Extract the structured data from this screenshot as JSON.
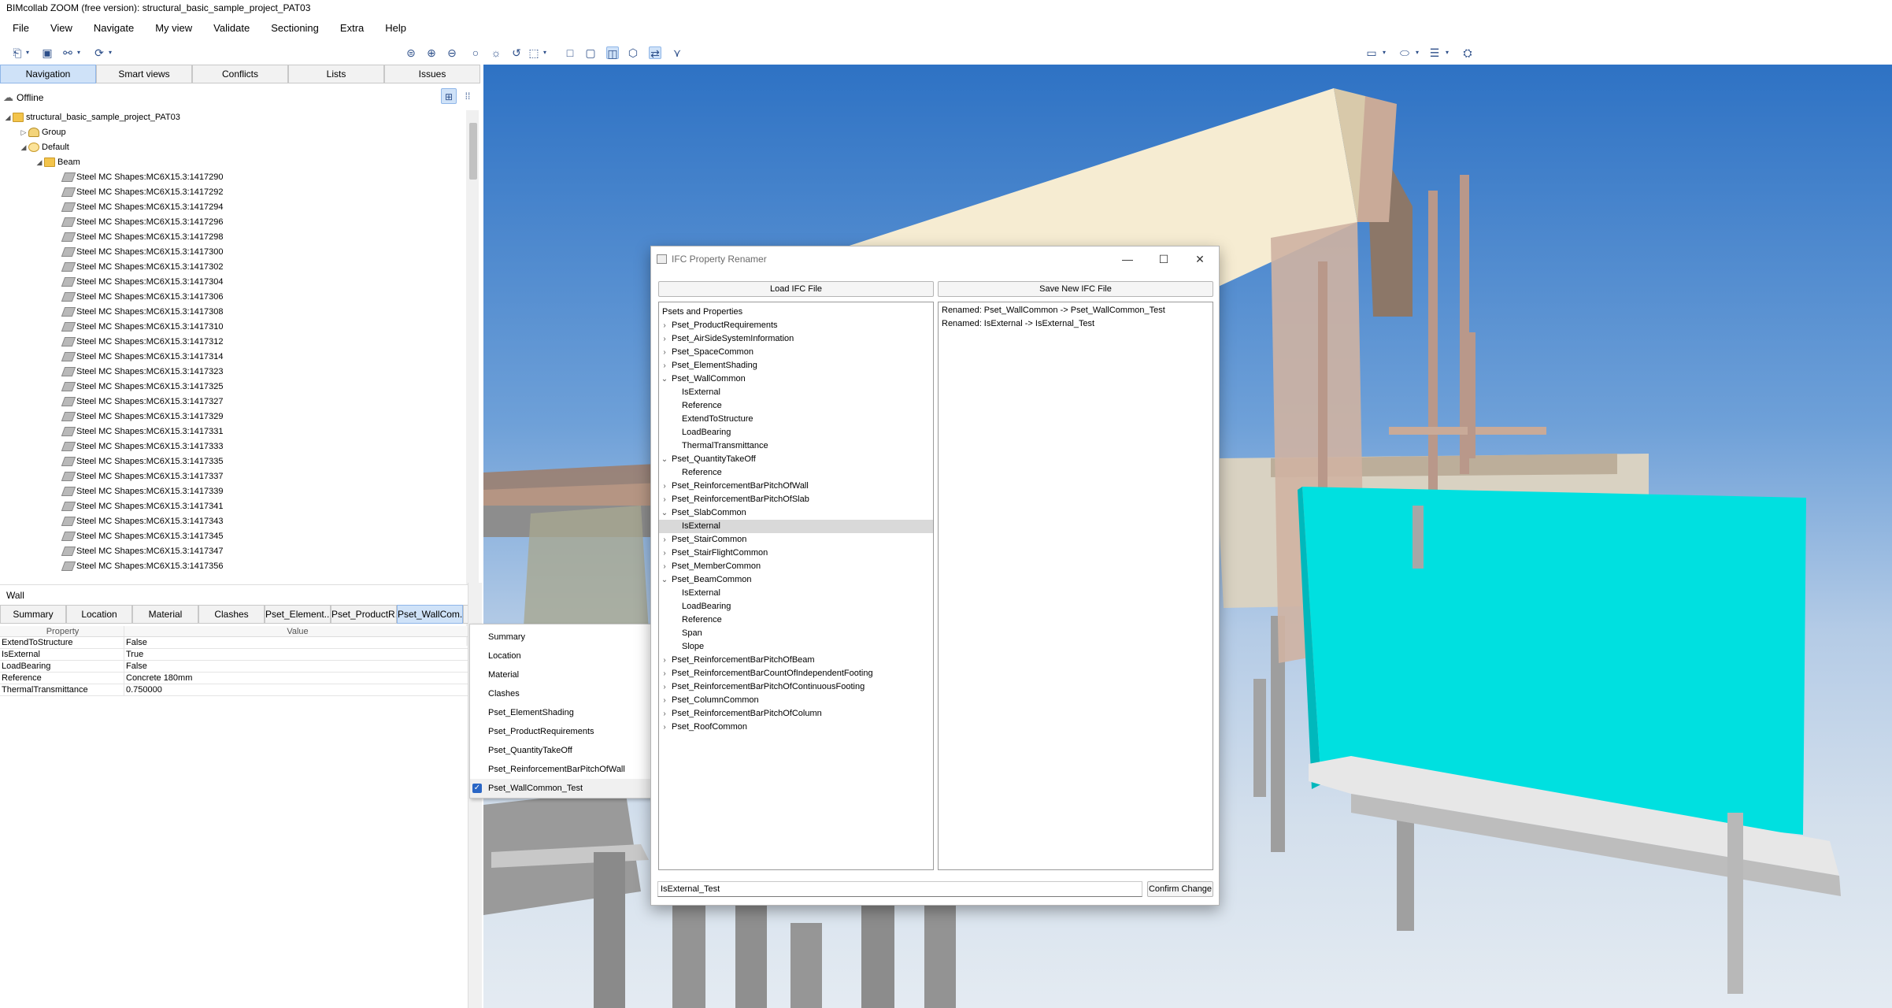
{
  "app": {
    "title": "BIMcollab ZOOM (free version): structural_basic_sample_project_PAT03"
  },
  "menu": [
    "File",
    "View",
    "Navigate",
    "My view",
    "Validate",
    "Sectioning",
    "Extra",
    "Help"
  ],
  "toolbar_icons": {
    "left": [
      "open-icon",
      "save-icon",
      "link-icon",
      "refresh-icon"
    ],
    "center": [
      "zoom-fit-icon",
      "zoom-in-icon",
      "zoom-out-icon",
      "target-icon",
      "sun-icon",
      "rotate-icon",
      "select-icon",
      "box-icon",
      "box-filled-icon",
      "section-box-icon",
      "cube-icon",
      "walk-icon",
      "measure-icon"
    ],
    "right": [
      "line-style-icon",
      "ellipse-icon",
      "menu-lines-icon",
      "settings-icon"
    ]
  },
  "nav_tabs": [
    "Navigation",
    "Smart views",
    "Conflicts",
    "Lists",
    "Issues"
  ],
  "status": {
    "offline": "Offline"
  },
  "tree": {
    "project": "structural_basic_sample_project_PAT03",
    "group": "Group",
    "default": "Default",
    "beam": "Beam",
    "items": [
      "Steel MC Shapes:MC6X15.3:1417290",
      "Steel MC Shapes:MC6X15.3:1417292",
      "Steel MC Shapes:MC6X15.3:1417294",
      "Steel MC Shapes:MC6X15.3:1417296",
      "Steel MC Shapes:MC6X15.3:1417298",
      "Steel MC Shapes:MC6X15.3:1417300",
      "Steel MC Shapes:MC6X15.3:1417302",
      "Steel MC Shapes:MC6X15.3:1417304",
      "Steel MC Shapes:MC6X15.3:1417306",
      "Steel MC Shapes:MC6X15.3:1417308",
      "Steel MC Shapes:MC6X15.3:1417310",
      "Steel MC Shapes:MC6X15.3:1417312",
      "Steel MC Shapes:MC6X15.3:1417314",
      "Steel MC Shapes:MC6X15.3:1417323",
      "Steel MC Shapes:MC6X15.3:1417325",
      "Steel MC Shapes:MC6X15.3:1417327",
      "Steel MC Shapes:MC6X15.3:1417329",
      "Steel MC Shapes:MC6X15.3:1417331",
      "Steel MC Shapes:MC6X15.3:1417333",
      "Steel MC Shapes:MC6X15.3:1417335",
      "Steel MC Shapes:MC6X15.3:1417337",
      "Steel MC Shapes:MC6X15.3:1417339",
      "Steel MC Shapes:MC6X15.3:1417341",
      "Steel MC Shapes:MC6X15.3:1417343",
      "Steel MC Shapes:MC6X15.3:1417345",
      "Steel MC Shapes:MC6X15.3:1417347",
      "Steel MC Shapes:MC6X15.3:1417356"
    ]
  },
  "properties": {
    "title": "Wall",
    "tabs": [
      "Summary",
      "Location",
      "Material",
      "Clashes",
      "Pset_Element...",
      "Pset_ProductR...",
      "Pset_WallCom..."
    ],
    "columns": [
      "Property",
      "Value"
    ],
    "rows": [
      [
        "ExtendToStructure",
        "False"
      ],
      [
        "IsExternal",
        "True"
      ],
      [
        "LoadBearing",
        "False"
      ],
      [
        "Reference",
        "Concrete 180mm"
      ],
      [
        "ThermalTransmittance",
        "0.750000"
      ]
    ]
  },
  "dropdown": {
    "items": [
      "Summary",
      "Location",
      "Material",
      "Clashes",
      "Pset_ElementShading",
      "Pset_ProductRequirements",
      "Pset_QuantityTakeOff",
      "Pset_ReinforcementBarPitchOfWall",
      "Pset_WallCommon_Test"
    ],
    "checked": "Pset_WallCommon_Test"
  },
  "dialog": {
    "title": "IFC Property Renamer",
    "load_button": "Load IFC File",
    "save_button": "Save New IFC File",
    "tree_header": "Psets and Properties",
    "tree": [
      {
        "label": "Pset_ProductRequirements",
        "level": 0,
        "state": "collapsed"
      },
      {
        "label": "Pset_AirSideSystemInformation",
        "level": 0,
        "state": "collapsed"
      },
      {
        "label": "Pset_SpaceCommon",
        "level": 0,
        "state": "collapsed"
      },
      {
        "label": "Pset_ElementShading",
        "level": 0,
        "state": "collapsed"
      },
      {
        "label": "Pset_WallCommon",
        "level": 0,
        "state": "expanded"
      },
      {
        "label": "IsExternal",
        "level": 1
      },
      {
        "label": "Reference",
        "level": 1
      },
      {
        "label": "ExtendToStructure",
        "level": 1
      },
      {
        "label": "LoadBearing",
        "level": 1
      },
      {
        "label": "ThermalTransmittance",
        "level": 1
      },
      {
        "label": "Pset_QuantityTakeOff",
        "level": 0,
        "state": "expanded"
      },
      {
        "label": "Reference",
        "level": 1
      },
      {
        "label": "Pset_ReinforcementBarPitchOfWall",
        "level": 0,
        "state": "collapsed"
      },
      {
        "label": "Pset_ReinforcementBarPitchOfSlab",
        "level": 0,
        "state": "collapsed"
      },
      {
        "label": "Pset_SlabCommon",
        "level": 0,
        "state": "expanded"
      },
      {
        "label": "IsExternal",
        "level": 1,
        "selected": true
      },
      {
        "label": "Pset_StairCommon",
        "level": 0,
        "state": "collapsed"
      },
      {
        "label": "Pset_StairFlightCommon",
        "level": 0,
        "state": "collapsed"
      },
      {
        "label": "Pset_MemberCommon",
        "level": 0,
        "state": "collapsed"
      },
      {
        "label": "Pset_BeamCommon",
        "level": 0,
        "state": "expanded"
      },
      {
        "label": "IsExternal",
        "level": 1
      },
      {
        "label": "LoadBearing",
        "level": 1
      },
      {
        "label": "Reference",
        "level": 1
      },
      {
        "label": "Span",
        "level": 1
      },
      {
        "label": "Slope",
        "level": 1
      },
      {
        "label": "Pset_ReinforcementBarPitchOfBeam",
        "level": 0,
        "state": "collapsed"
      },
      {
        "label": "Pset_ReinforcementBarCountOfIndependentFooting",
        "level": 0,
        "state": "collapsed"
      },
      {
        "label": "Pset_ReinforcementBarPitchOfContinuousFooting",
        "level": 0,
        "state": "collapsed"
      },
      {
        "label": "Pset_ColumnCommon",
        "level": 0,
        "state": "collapsed"
      },
      {
        "label": "Pset_ReinforcementBarPitchOfColumn",
        "level": 0,
        "state": "collapsed"
      },
      {
        "label": "Pset_RoofCommon",
        "level": 0,
        "state": "collapsed"
      }
    ],
    "log": [
      "Renamed: Pset_WallCommon -> Pset_WallCommon_Test",
      "Renamed: IsExternal -> IsExternal_Test"
    ],
    "input_value": "IsExternal_Test",
    "confirm_button": "Confirm Change"
  },
  "colors": {
    "tab_active_bg": "#cfe2f8",
    "selected_row": "#d9d9d9",
    "sky_top": "#2e72c4",
    "wall_cyan": "#00e0e0",
    "roof": "#f6ecd2",
    "timber": "#c9aa98"
  }
}
